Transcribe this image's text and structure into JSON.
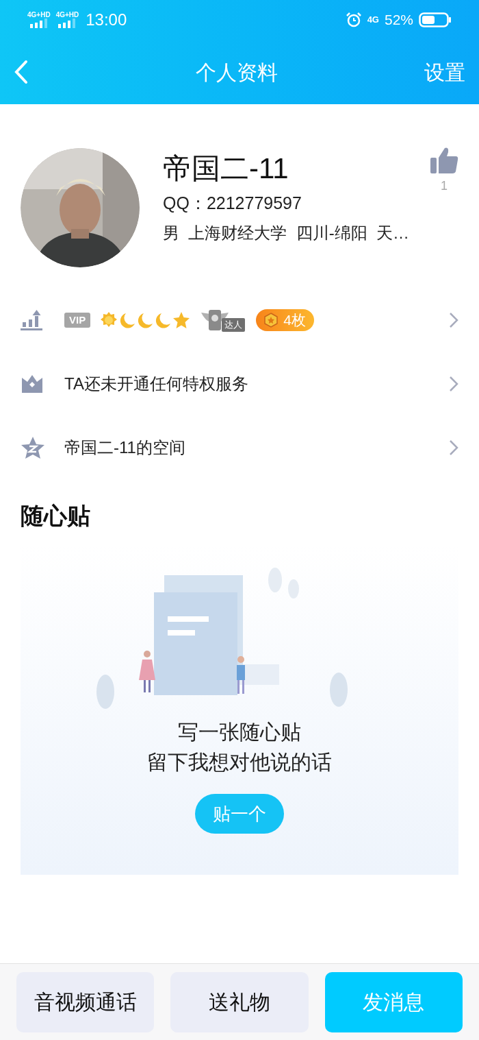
{
  "status_bar": {
    "sim_labels": [
      "4G+HD",
      "4G+HD"
    ],
    "time": "13:00",
    "network": "4G",
    "battery": "52%"
  },
  "header": {
    "title": "个人资料",
    "action": "设置"
  },
  "profile": {
    "name": "帝国二-11",
    "qq": "QQ：2212779597",
    "info": "男  上海财经大学  四川-绵阳  天…",
    "likes": "1"
  },
  "rows": [
    {
      "kind": "level",
      "vip": "VIP",
      "levels": [
        {
          "kind": "sun"
        },
        {
          "kind": "moon"
        },
        {
          "kind": "moon"
        },
        {
          "kind": "moon"
        },
        {
          "kind": "star"
        }
      ],
      "talent": "达人",
      "medal": "4枚"
    },
    {
      "kind": "privilege",
      "text": "TA还未开通任何特权服务"
    },
    {
      "kind": "space",
      "text": "帝国二-11的空间"
    }
  ],
  "notes": {
    "title": "随心贴",
    "lines": [
      "写一张随心贴",
      "留下我想对他说的话"
    ],
    "button": "贴一个"
  },
  "actions": [
    {
      "label": "音视频通话",
      "primary": false
    },
    {
      "label": "送礼物",
      "primary": false
    },
    {
      "label": "发消息",
      "primary": true
    }
  ]
}
